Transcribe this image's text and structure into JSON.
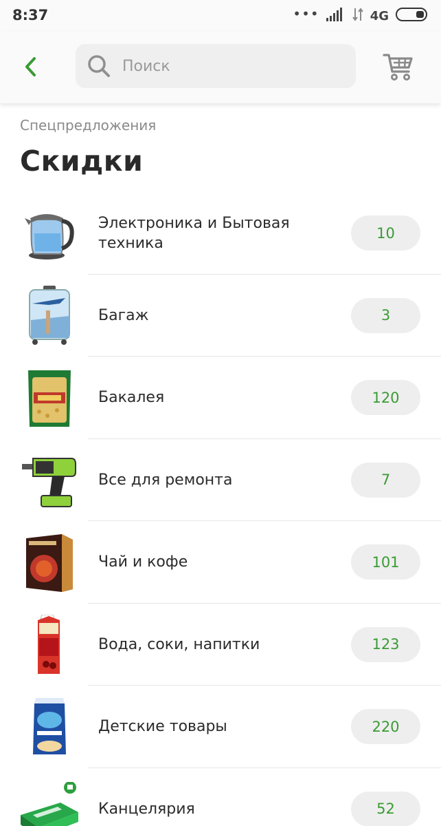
{
  "status_bar": {
    "time": "8:37",
    "dots": "•••",
    "network": "4G"
  },
  "header": {
    "search_placeholder": "Поиск"
  },
  "breadcrumb": "Спецпредложения",
  "title": "Скидки",
  "categories": [
    {
      "label": "Электроника и Бытовая техника",
      "count": "10"
    },
    {
      "label": "Багаж",
      "count": "3"
    },
    {
      "label": "Бакалея",
      "count": "120"
    },
    {
      "label": "Все для ремонта",
      "count": "7"
    },
    {
      "label": "Чай и кофе",
      "count": "101"
    },
    {
      "label": "Вода, соки, напитки",
      "count": "123"
    },
    {
      "label": "Детские товары",
      "count": "220"
    },
    {
      "label": "Канцелярия",
      "count": "52"
    }
  ],
  "colors": {
    "accent": "#3a9b34",
    "badge_bg": "#eeeeee",
    "search_bg": "#efefef"
  },
  "icons": [
    "chevron-left-icon",
    "search-icon",
    "cart-icon"
  ]
}
